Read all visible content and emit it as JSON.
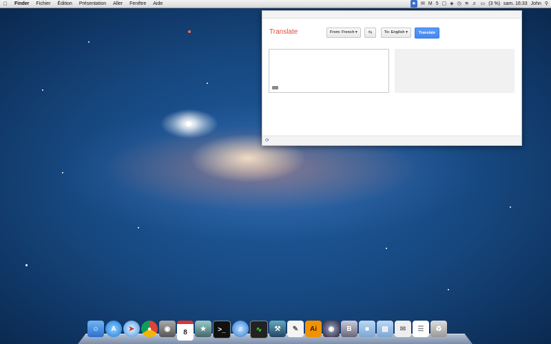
{
  "menubar": {
    "app": "Finder",
    "items": [
      "Fichier",
      "Édition",
      "Présentation",
      "Aller",
      "Fenêtre",
      "Aide"
    ],
    "battery": "(3 %)",
    "clock": "sam. 16:33",
    "user": "John",
    "status_icons": [
      "translate-icon",
      "mail-icon",
      "gmail-icon",
      "five-icon",
      "screens-icon",
      "dropbox-icon",
      "timemachine-icon",
      "wifi-icon",
      "volume-icon",
      "battery-icon",
      "search-icon"
    ]
  },
  "translate": {
    "title": "Translate",
    "from": "From: French",
    "to": "To: English",
    "button": "Translate",
    "source_text": "",
    "output_text": ""
  },
  "dock": {
    "items": [
      "finder",
      "app-store",
      "safari",
      "chrome",
      "facetime",
      "calendar",
      "iphoto",
      "terminal",
      "itunes",
      "activity-monitor",
      "xcode",
      "textedit",
      "illustrator",
      "eclipse",
      "bbedit",
      "folder",
      "documents",
      "mail-folder",
      "textedit-doc",
      "trash"
    ],
    "calendar_day": "8",
    "illustrator_label": "Ai"
  },
  "colors": {
    "translate_title": "#dd4b39",
    "translate_button": "#4787ed"
  }
}
